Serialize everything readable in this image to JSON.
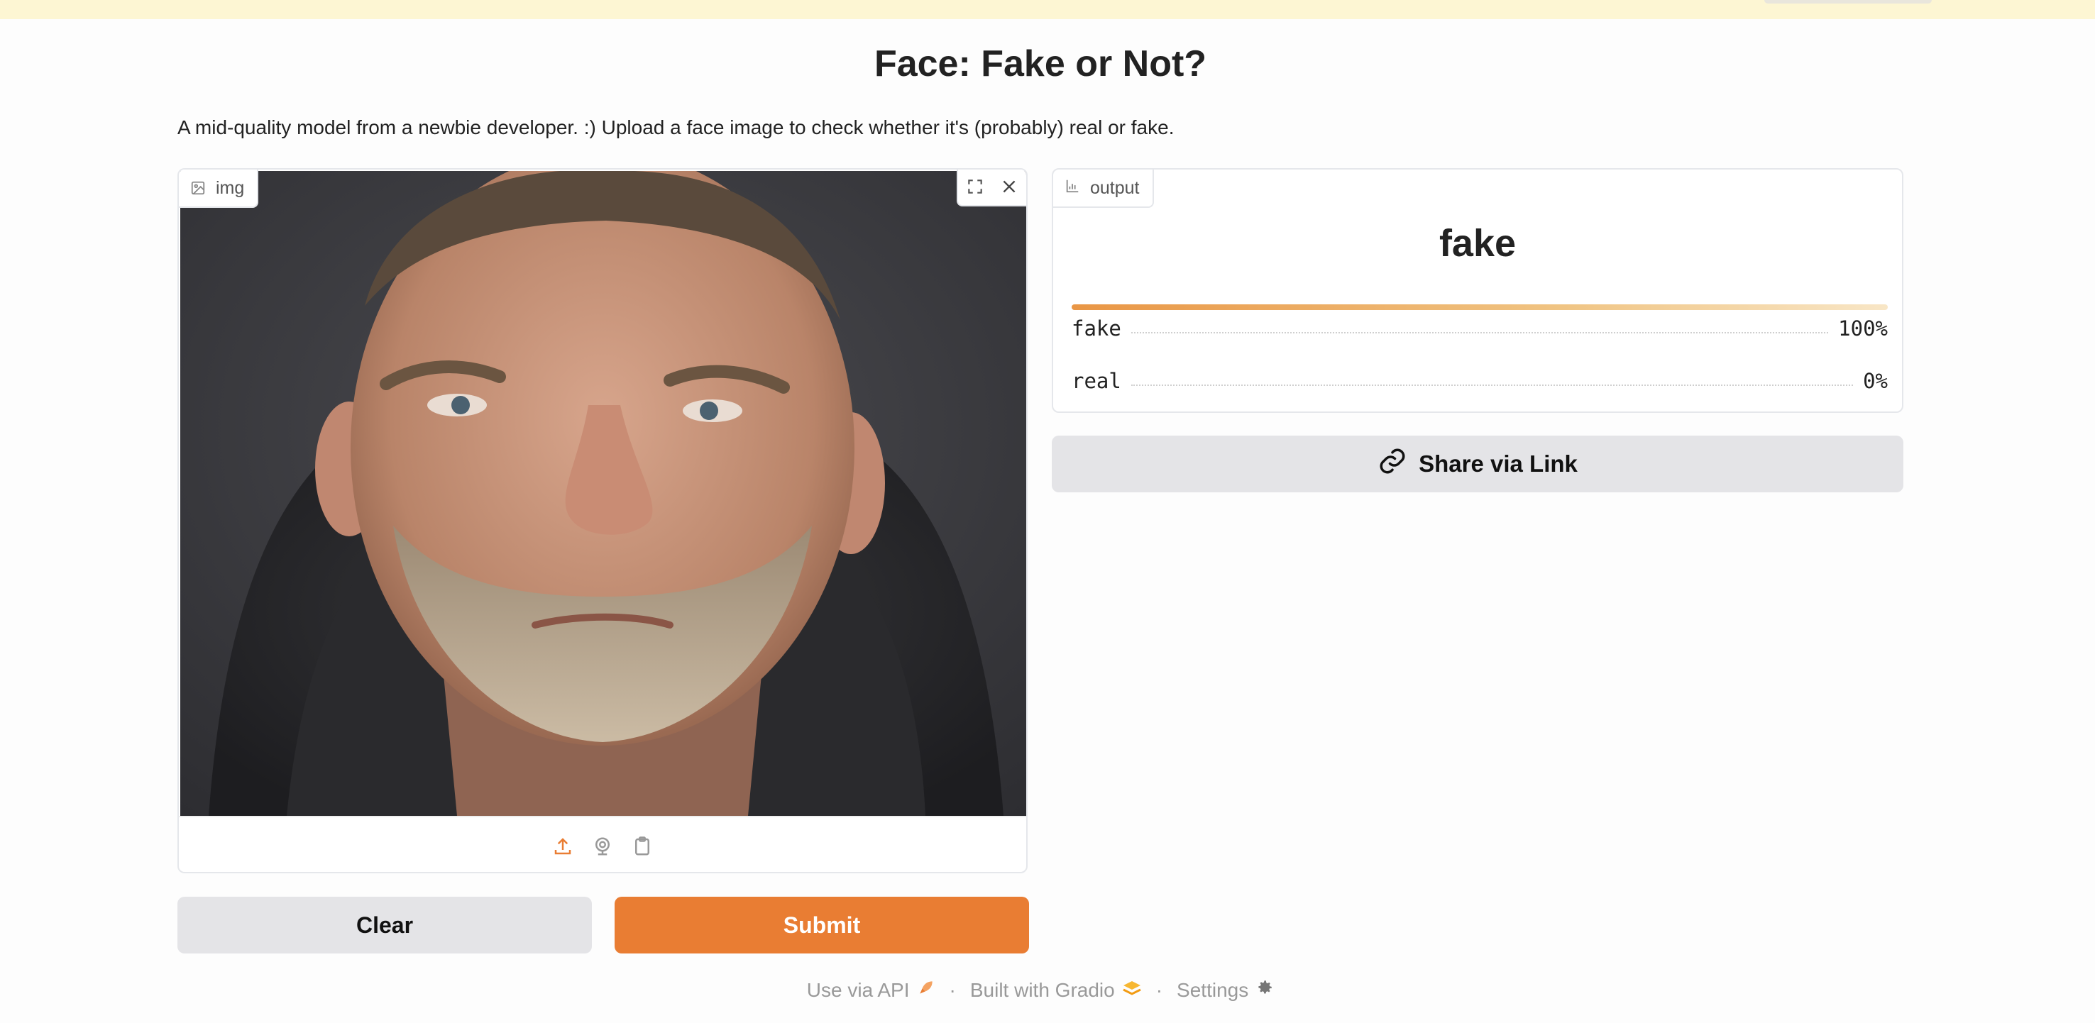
{
  "header": {
    "title": "Face: Fake or Not?",
    "description": "A mid-quality model from a newbie developer. :) Upload a face image to check whether it's (probably) real or fake."
  },
  "input": {
    "label": "img",
    "icon": "image-icon",
    "tools": [
      "fullscreen-icon",
      "close-icon"
    ],
    "sources": [
      "upload-icon",
      "webcam-icon",
      "clipboard-icon"
    ]
  },
  "actions": {
    "clear_label": "Clear",
    "submit_label": "Submit"
  },
  "output": {
    "label": "output",
    "icon": "bar-chart-icon",
    "predicted": "fake",
    "confidences": [
      {
        "label": "fake",
        "value_text": "100%",
        "value": 1.0
      },
      {
        "label": "real",
        "value_text": "0%",
        "value": 0.0
      }
    ]
  },
  "share": {
    "label": "Share via Link",
    "icon": "link-icon"
  },
  "footer": {
    "api": "Use via API",
    "built": "Built with Gradio",
    "settings": "Settings",
    "separator": "·"
  },
  "colors": {
    "accent": "#e97d33",
    "banner": "#fdf6d3",
    "button_secondary": "#e4e4e7"
  }
}
